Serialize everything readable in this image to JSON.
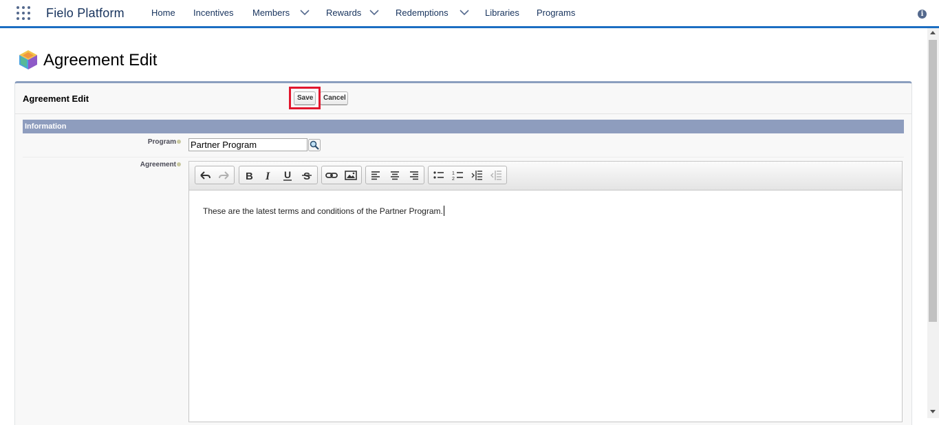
{
  "app": {
    "name": "Fielo Platform"
  },
  "nav": [
    {
      "label": "Home"
    },
    {
      "label": "Incentives"
    },
    {
      "label": "Members"
    },
    {
      "label": "Rewards"
    },
    {
      "label": "Redemptions"
    },
    {
      "label": "Libraries"
    },
    {
      "label": "Programs"
    }
  ],
  "page": {
    "title": "Agreement Edit"
  },
  "form": {
    "panel_title": "Agreement Edit",
    "save_label": "Save",
    "cancel_label": "Cancel",
    "section_title": "Information",
    "program_label": "Program",
    "program_value": "Partner Program",
    "agreement_label": "Agreement",
    "agreement_text": "These are the latest terms and conditions of the Partner Program."
  },
  "editor_toolbar": [
    "undo-icon",
    "redo-icon",
    "bold-icon",
    "italic-icon",
    "underline-icon",
    "strikethrough-icon",
    "link-icon",
    "image-icon",
    "align-left-icon",
    "align-center-icon",
    "align-right-icon",
    "bulleted-list-icon",
    "numbered-list-icon",
    "indent-icon",
    "outdent-icon"
  ],
  "colors": {
    "accent": "#1b6ec2",
    "section_bar": "#8e9dbe",
    "highlight": "#e2162d"
  }
}
